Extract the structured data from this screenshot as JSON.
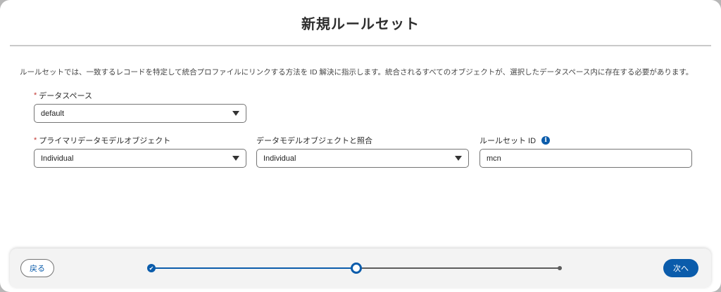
{
  "dialog": {
    "title": "新規ルールセット",
    "description": "ルールセットでは、一致するレコードを特定して統合プロファイルにリンクする方法を ID 解決に指示します。統合されるすべてのオブジェクトが、選択したデータスペース内に存在する必要があります。"
  },
  "form": {
    "data_space": {
      "required_mark": "*",
      "label": "データスペース",
      "value": "default"
    },
    "primary_dmo": {
      "required_mark": "*",
      "label": "プライマリデータモデルオブジェクト",
      "value": "Individual"
    },
    "reconcile_dmo": {
      "label": "データモデルオブジェクトと照合",
      "value": "Individual"
    },
    "ruleset_id": {
      "label": "ルールセット ID",
      "info_glyph": "i",
      "value": "mcn"
    }
  },
  "footer": {
    "back_label": "戻る",
    "next_label": "次へ",
    "progress": {
      "total_steps": 3,
      "current_step": 2,
      "complete_glyph": "✔"
    }
  },
  "colors": {
    "brand": "#0b5cab",
    "required": "#c23934",
    "border": "#747474"
  },
  "icons": {
    "select_caret": "caret-down-icon",
    "info": "info-icon",
    "step_complete": "check-icon"
  }
}
